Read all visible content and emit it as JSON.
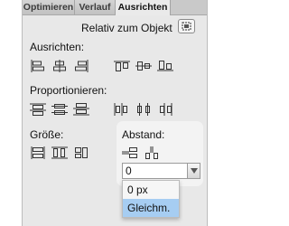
{
  "tabs": [
    {
      "label": "Optimieren",
      "active": false
    },
    {
      "label": "Verlauf",
      "active": false
    },
    {
      "label": "Ausrichten",
      "active": true
    }
  ],
  "relative_label": "Relativ zum Objekt",
  "sections": {
    "ausrichten": "Ausrichten:",
    "proportionieren": "Proportionieren:",
    "groesse": "Größe:",
    "abstand": "Abstand:"
  },
  "spacing": {
    "value": "0",
    "options": [
      "0 px",
      "Gleichm."
    ],
    "highlighted": "Gleichm."
  },
  "icons": {
    "align": [
      "align-left-icon",
      "align-center-h-icon",
      "align-right-icon",
      "align-top-icon",
      "align-middle-v-icon",
      "align-bottom-icon"
    ],
    "distribute": [
      "distribute-top-icon",
      "distribute-center-v-icon",
      "distribute-bottom-icon",
      "distribute-left-icon",
      "distribute-center-h-icon",
      "distribute-right-icon"
    ],
    "size": [
      "match-width-icon",
      "match-height-icon",
      "match-size-icon"
    ],
    "spacing": [
      "space-vertical-icon",
      "space-horizontal-icon"
    ]
  },
  "colors": {
    "panel": "#e8e8e8",
    "highlight": "#a6cdf2",
    "icon": "#333333"
  }
}
